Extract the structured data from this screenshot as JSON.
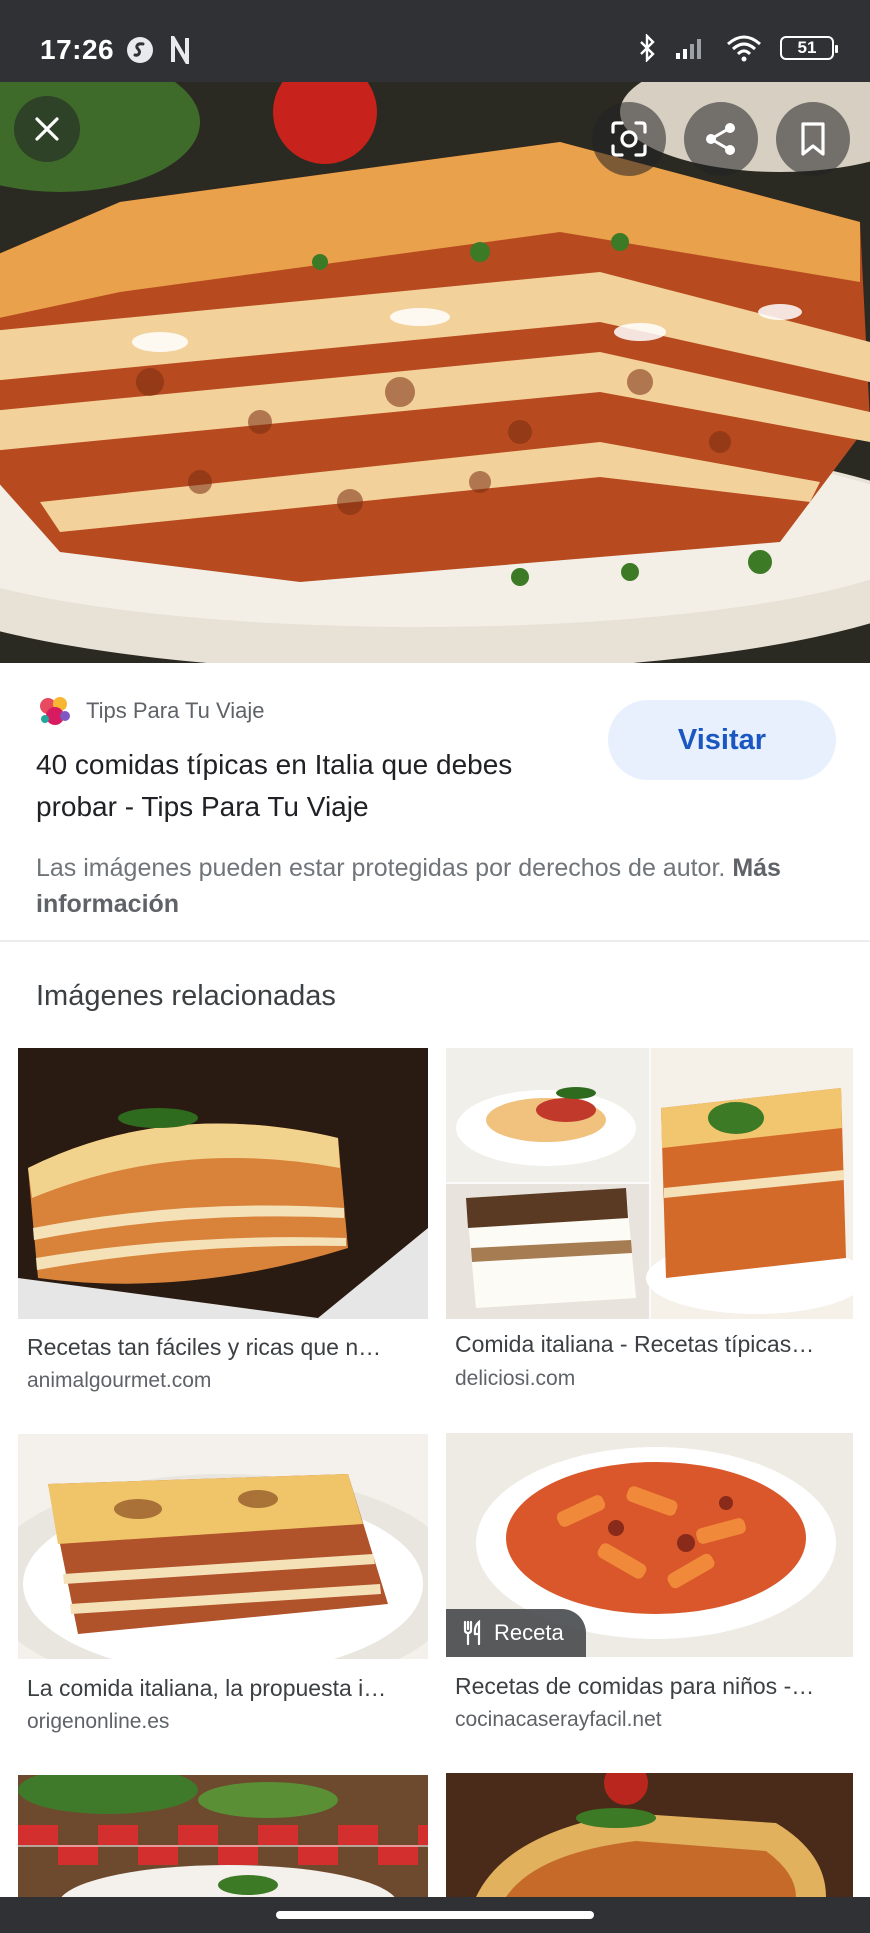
{
  "status_bar": {
    "time": "17:26",
    "battery": "51"
  },
  "hero": {
    "close_label": "close",
    "lens_label": "lens",
    "share_label": "share",
    "save_label": "save"
  },
  "source": {
    "site_name": "Tips Para Tu Viaje",
    "title": "40 comidas típicas en Italia que debes probar - Tips Para Tu Viaje",
    "visit_label": "Visitar",
    "copyright_text": "Las imágenes pueden estar protegidas por derechos de autor.",
    "more_info_label": "Más información"
  },
  "related": {
    "heading": "Imágenes relacionadas",
    "badge_label": "Receta",
    "items": [
      {
        "title": "Recetas tan fáciles y ricas que n…",
        "domain": "animalgourmet.com"
      },
      {
        "title": "Comida italiana - Recetas típicas…",
        "domain": "deliciosi.com"
      },
      {
        "title": "La comida italiana, la propuesta i…",
        "domain": "origenonline.es"
      },
      {
        "title": "Recetas de comidas para niños -…",
        "domain": "cocinacaserayfacil.net"
      }
    ]
  },
  "colors": {
    "status_bar": "#303134",
    "visit_bg": "#e8f0fe",
    "visit_text": "#1a57c0",
    "lasagna_sauce": "#b5451b",
    "pasta": "#f1c27d"
  }
}
